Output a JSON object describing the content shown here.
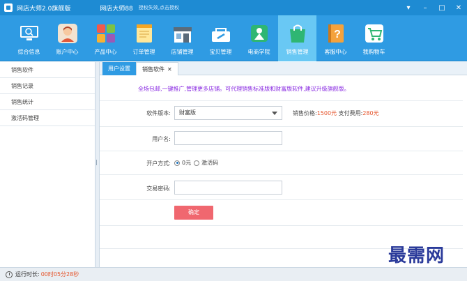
{
  "titlebar": {
    "app_title": "网店大师2.0旗舰版",
    "shop_name": "网店大师88",
    "auth_status": "授权失效,点击授权",
    "dropdown_glyph": "▾",
    "minimize_glyph": "–",
    "maximize_glyph": "□",
    "close_glyph": "✕"
  },
  "nav": {
    "items": [
      {
        "label": "综合信息",
        "icon": "monitor-icon",
        "color": "#ffffff"
      },
      {
        "label": "账户中心",
        "icon": "user-icon",
        "color": "#f3e3d0"
      },
      {
        "label": "产品中心",
        "icon": "apps-icon",
        "color": "#ffffff"
      },
      {
        "label": "订单管理",
        "icon": "notepad-icon",
        "color": "#ffe79a"
      },
      {
        "label": "店铺管理",
        "icon": "store-icon",
        "color": "#ffffff"
      },
      {
        "label": "宝贝管理",
        "icon": "tools-icon",
        "color": "#ffffff"
      },
      {
        "label": "电商学院",
        "icon": "school-icon",
        "color": "#ffffff"
      },
      {
        "label": "销售管理",
        "icon": "bag-icon",
        "color": "#ffffff"
      },
      {
        "label": "客服中心",
        "icon": "help-book-icon",
        "color": "#f4a23c"
      },
      {
        "label": "我购物车",
        "icon": "cart-icon",
        "color": "#ffffff"
      }
    ],
    "active_index": 7
  },
  "sidebar": {
    "items": [
      {
        "label": "销售软件"
      },
      {
        "label": "销售记录"
      },
      {
        "label": "销售统计"
      },
      {
        "label": "激活码管理"
      }
    ]
  },
  "tabs": {
    "user_settings": "用户设置",
    "sales_software": "销售软件",
    "close_glyph": "✕"
  },
  "form": {
    "notice": "全场包邮,一键推广,管理更多店铺。可代理销售标准版和财富版软件,建议升级旗舰版。",
    "version_label": "软件版本:",
    "version_value": "财富版",
    "price_label": "销售价格:",
    "price_value": "1500元",
    "fee_label": "支付费用:",
    "fee_value": "280元",
    "username_label": "用户名:",
    "username_value": "",
    "open_mode_label": "开户方式:",
    "option_zero": "0元",
    "option_code": "激活码",
    "password_label": "交易密码:",
    "password_value": "",
    "confirm": "确定"
  },
  "status": {
    "runtime_label": "运行时长:",
    "runtime_value": "00时05分28秒"
  },
  "watermark": "最需网",
  "colors": {
    "titlebar": "#1e8bd3",
    "navbar": "#2f9be3",
    "nav_active": "#69c8f4",
    "notice_text": "#8a2be2",
    "price": "#e5532a",
    "confirm_button": "#f0676f"
  }
}
